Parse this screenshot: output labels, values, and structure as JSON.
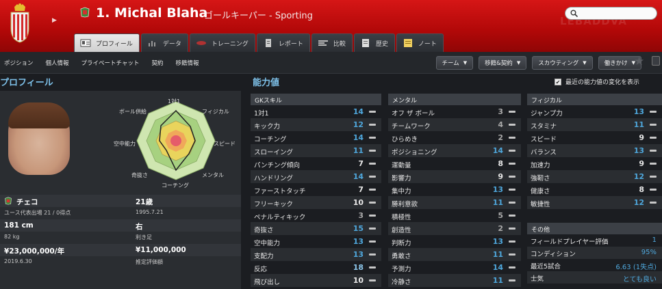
{
  "header": {
    "number_name": "1. Michal Blaha",
    "subtitle": "ゴールキーパー - Sporting",
    "watermark": "LEBADDVA"
  },
  "tabs": [
    {
      "label": "プロフィール",
      "icon": "profile-icon",
      "active": true
    },
    {
      "label": "データ",
      "icon": "stats-icon"
    },
    {
      "label": "トレーニング",
      "icon": "training-icon"
    },
    {
      "label": "レポート",
      "icon": "report-icon"
    },
    {
      "label": "比較",
      "icon": "compare-icon"
    },
    {
      "label": "歴史",
      "icon": "history-icon"
    },
    {
      "label": "ノート",
      "icon": "notes-icon"
    }
  ],
  "subnav": [
    "ポジション",
    "個人情報",
    "プライベートチャット",
    "契約",
    "移籍情報"
  ],
  "actions": [
    "チーム",
    "移籍&契約",
    "スカウティング",
    "働きかけ"
  ],
  "profile": {
    "title": "プロフィール",
    "radar_labels": [
      "1対1",
      "フィジカル",
      "スピード",
      "メンタル",
      "コーチング",
      "奇抜さ",
      "空中能力",
      "ボール供給"
    ],
    "nationality": "チェコ",
    "age": "21歳",
    "youth_caps": "ユース代表出場 21 / 0得点",
    "dob": "1995.7.21",
    "height": "181 cm",
    "foot": "右",
    "weight": "82 kg",
    "foot_label": "利き足",
    "wage": "¥23,000,000/年",
    "value": "¥11,000,000",
    "contract": "2019.6.30",
    "value_label": "推定評価額"
  },
  "attributes": {
    "title": "能力値",
    "show_changes": "最近の能力値の変化を表示",
    "gk": {
      "header": "GKスキル",
      "rows": [
        {
          "name": "1対1",
          "value": "14",
          "tone": "blue"
        },
        {
          "name": "キック力",
          "value": "12",
          "tone": "blue"
        },
        {
          "name": "コーチング",
          "value": "14",
          "tone": "blue"
        },
        {
          "name": "スローイング",
          "value": "11",
          "tone": "blue"
        },
        {
          "name": "パンチング傾向",
          "value": "7",
          "tone": "white"
        },
        {
          "name": "ハンドリング",
          "value": "14",
          "tone": "blue"
        },
        {
          "name": "ファーストタッチ",
          "value": "7",
          "tone": "white"
        },
        {
          "name": "フリーキック",
          "value": "10",
          "tone": "white"
        },
        {
          "name": "ペナルティキック",
          "value": "3",
          "tone": "grey"
        },
        {
          "name": "奇抜さ",
          "value": "15",
          "tone": "blue"
        },
        {
          "name": "空中能力",
          "value": "13",
          "tone": "blue"
        },
        {
          "name": "支配力",
          "value": "13",
          "tone": "blue"
        },
        {
          "name": "反応",
          "value": "18",
          "tone": "lblue"
        },
        {
          "name": "飛び出し",
          "value": "10",
          "tone": "white"
        }
      ]
    },
    "mental": {
      "header": "メンタル",
      "rows": [
        {
          "name": "オフ ザ ボール",
          "value": "3",
          "tone": "grey"
        },
        {
          "name": "チームワーク",
          "value": "4",
          "tone": "grey"
        },
        {
          "name": "ひらめき",
          "value": "2",
          "tone": "grey"
        },
        {
          "name": "ポジショニング",
          "value": "14",
          "tone": "blue"
        },
        {
          "name": "運動量",
          "value": "8",
          "tone": "white"
        },
        {
          "name": "影響力",
          "value": "9",
          "tone": "white"
        },
        {
          "name": "集中力",
          "value": "13",
          "tone": "blue"
        },
        {
          "name": "勝利意欲",
          "value": "11",
          "tone": "blue"
        },
        {
          "name": "積極性",
          "value": "5",
          "tone": "grey"
        },
        {
          "name": "創造性",
          "value": "2",
          "tone": "grey"
        },
        {
          "name": "判断力",
          "value": "13",
          "tone": "blue"
        },
        {
          "name": "勇敢さ",
          "value": "11",
          "tone": "blue"
        },
        {
          "name": "予測力",
          "value": "14",
          "tone": "blue"
        },
        {
          "name": "冷静さ",
          "value": "11",
          "tone": "blue"
        }
      ]
    },
    "physical": {
      "header": "フィジカル",
      "rows": [
        {
          "name": "ジャンプ力",
          "value": "13",
          "tone": "blue"
        },
        {
          "name": "スタミナ",
          "value": "11",
          "tone": "blue"
        },
        {
          "name": "スピード",
          "value": "9",
          "tone": "white"
        },
        {
          "name": "バランス",
          "value": "13",
          "tone": "blue"
        },
        {
          "name": "加速力",
          "value": "9",
          "tone": "white"
        },
        {
          "name": "強靭さ",
          "value": "12",
          "tone": "blue"
        },
        {
          "name": "健康さ",
          "value": "8",
          "tone": "white"
        },
        {
          "name": "敏捷性",
          "value": "12",
          "tone": "blue"
        }
      ]
    },
    "other": {
      "header": "その他",
      "rows": [
        {
          "name": "フィールドプレイヤー評価",
          "value": "1"
        },
        {
          "name": "コンディション",
          "value": "95%"
        },
        {
          "name": "最近5試合",
          "value": "6.63 (1失点)"
        },
        {
          "name": "士気",
          "value": "とても良い"
        }
      ]
    }
  },
  "colors": {
    "header_red": "#c70e0e",
    "accent_blue": "#4fa8dd",
    "panel": "#2a2d31"
  }
}
